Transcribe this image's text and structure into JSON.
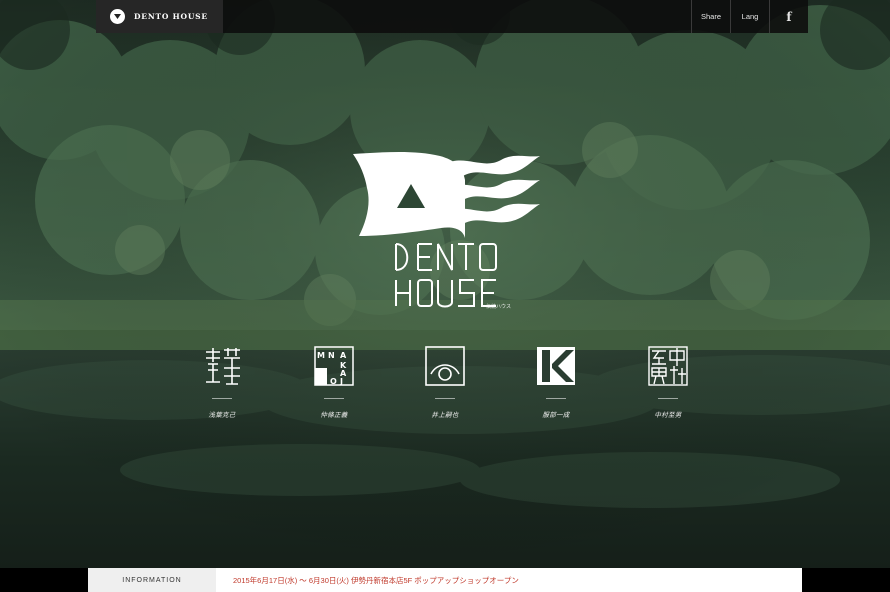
{
  "header": {
    "brand_icon": "chevron-down-icon",
    "brand_label": "DENTO HOUSE",
    "nav": {
      "share": "Share",
      "lang": "Lang",
      "facebook": "f"
    }
  },
  "hero": {
    "logo_mark": "dento-house-flag-logo",
    "wordmark": "DENTO HOUSE",
    "wordmark_sub": "伝統ハウス"
  },
  "designers": [
    {
      "name": "浅葉克己",
      "mark": "浅葉"
    },
    {
      "name": "仲條正義",
      "mark": "MNAKAJO"
    },
    {
      "name": "井上嗣也",
      "mark": "eye"
    },
    {
      "name": "服部一成",
      "mark": "K"
    },
    {
      "name": "中村至男",
      "mark": "至中男村"
    }
  ],
  "information": {
    "label": "INFORMATION",
    "text": "2015年6月17日(水) 〜 6月30日(火) 伊勢丹新宿本店5F ポップアップショップオープン"
  },
  "colors": {
    "forest": "#2e4a36",
    "pond": "#1a2a22",
    "topbar": "#0c0c0c",
    "brand_bg": "#262626",
    "info_link": "#c0392b"
  }
}
